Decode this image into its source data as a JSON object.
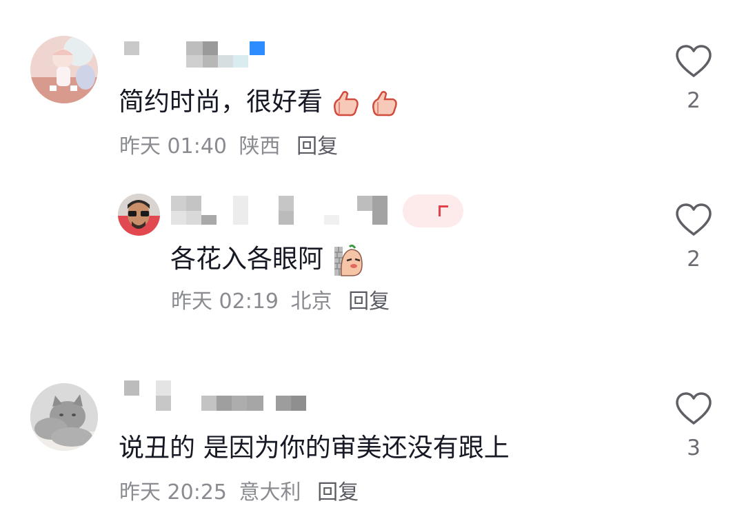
{
  "comments": [
    {
      "content": "简约时尚，很好看",
      "time": "昨天 01:40",
      "location": "陕西",
      "reply_label": "回复",
      "likes": "2",
      "emojis": [
        "thumbs-up-emoji",
        "thumbs-up-emoji"
      ]
    },
    {
      "content": "各花入各眼阿",
      "time": "昨天 02:19",
      "location": "北京",
      "reply_label": "回复",
      "likes": "2",
      "emojis": [
        "peeking-emoji"
      ],
      "is_reply": true
    },
    {
      "content": "说丑的 是因为你的审美还没有跟上",
      "time": "昨天 20:25",
      "location": "意大利",
      "reply_label": "回复",
      "likes": "3"
    }
  ],
  "colors": {
    "text": "#161823",
    "meta": "#8a8b91",
    "icon": "#5f6066",
    "accent": "#2d8cff"
  }
}
